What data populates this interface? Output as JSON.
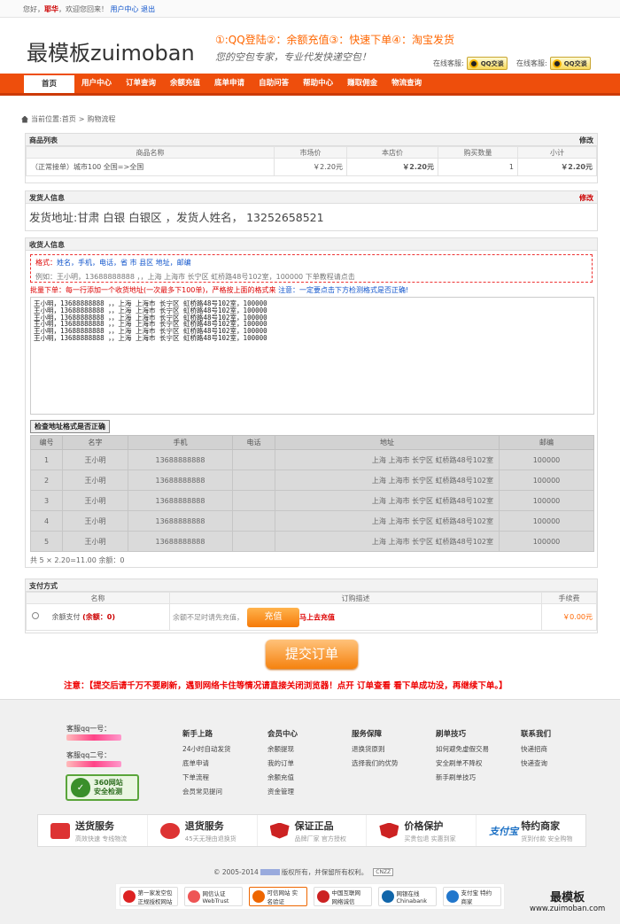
{
  "topbar": {
    "greeting": "您好，",
    "username": "耶华",
    "welcome": "，欢迎您回来！",
    "user_center": "用户中心",
    "logout": "退出"
  },
  "header": {
    "logo": "最模板zuimoban",
    "slogan1": "①:QQ登陆②：余额充值③：快速下单④：淘宝发货",
    "slogan2": "您的空包专家，专业代发快递空包！",
    "kf_label": "在线客服:",
    "qq_btn": "QQ交谈"
  },
  "nav": [
    "首页",
    "用户中心",
    "订单查询",
    "余额充值",
    "底单申请",
    "自助问答",
    "帮助中心",
    "赚取佣金",
    "物流查询"
  ],
  "breadcrumb": {
    "label": "当前位置:",
    "home": "首页",
    "sep": ">",
    "current": "购物流程"
  },
  "goods": {
    "title": "商品列表",
    "edit": "修改",
    "headers": [
      "商品名称",
      "市场价",
      "本店价",
      "购买数量",
      "小计"
    ],
    "row": {
      "name": "（正常接单）城市100 全国=>全国",
      "market": "￥2.20元",
      "shop": "￥2.20元",
      "qty": "1",
      "subtotal": "￥2.20元"
    }
  },
  "sender": {
    "title": "发货人信息",
    "edit": "修改",
    "address": "发货地址:甘肃 白银 白银区 ，发货人姓名， 13252658521"
  },
  "receiver": {
    "title": "收货人信息",
    "format_label": "格式：",
    "format_fields": "姓名，手机，电话，省 市 县区 地址，邮编",
    "example": "例如：王小明，13688888888 ，，上海 上海市 长宁区 虹桥路48号102室，100000 下单教程请点击",
    "batch_note": "批量下单：每一行添加一个收货地址(一次最多下100单)，严格按上面的格式来",
    "batch_note2": "注意：一定要点击下方检测格式是否正确!",
    "textarea": "王小明，13688888888 ，，上海 上海市 长宁区 虹桥路48号102室，100000\n王小明，13688888888 ，，上海 上海市 长宁区 虹桥路48号102室，100000\n王小明，13688888888 ，，上海 上海市 长宁区 虹桥路48号102室，100000\n王小明，13688888888 ，，上海 上海市 长宁区 虹桥路48号102室，100000\n王小明，13688888888 ，，上海 上海市 长宁区 虹桥路48号102室，100000\n王小明，13688888888 ，，上海 上海市 长宁区 虹桥路48号102室，100000",
    "check_btn": "检查地址格式是否正确",
    "parsed_headers": [
      "编号",
      "名字",
      "手机",
      "电话",
      "地址",
      "邮编"
    ],
    "parsed_rows": [
      [
        "1",
        "王小明",
        "13688888888",
        "",
        "上海 上海市 长宁区 虹桥路48号102室",
        "100000"
      ],
      [
        "2",
        "王小明",
        "13688888888",
        "",
        "上海 上海市 长宁区 虹桥路48号102室",
        "100000"
      ],
      [
        "3",
        "王小明",
        "13688888888",
        "",
        "上海 上海市 长宁区 虹桥路48号102室",
        "100000"
      ],
      [
        "4",
        "王小明",
        "13688888888",
        "",
        "上海 上海市 长宁区 虹桥路48号102室",
        "100000"
      ],
      [
        "5",
        "王小明",
        "13688888888",
        "",
        "上海 上海市 长宁区 虹桥路48号102室",
        "100000"
      ]
    ],
    "total": "共 5 × 2.20=11.00 余额：0"
  },
  "payment": {
    "title": "支付方式",
    "headers": [
      "名称",
      "订购描述",
      "手续费"
    ],
    "method": "余额支付",
    "balance": "(余额：0)",
    "desc": "余额不足时请先充值，",
    "recharge_btn": "充值",
    "recharge_link": "马上去充值",
    "fee": "￥0.00元"
  },
  "submit": "提交订单",
  "notice": "注意：【提交后请千万不要刷新，遇到网络卡住等情况请直接关闭浏览器！点开 订单查看 看下单成功没，再继续下单。】",
  "footer": {
    "kf1": "客服qq一号：",
    "kf2": "客服qq二号：",
    "cert360_1": "360网站",
    "cert360_2": "安全检测",
    "cols": [
      {
        "h": "新手上路",
        "items": [
          "24小时自动发货",
          "底单申请",
          "下单流程",
          "会员常见提问"
        ]
      },
      {
        "h": "会员中心",
        "items": [
          "余额提现",
          "我的订单",
          "余额充值",
          "资金管理"
        ]
      },
      {
        "h": "服务保障",
        "items": [
          "退换货原则",
          "选择我们的优势"
        ]
      },
      {
        "h": "刷单技巧",
        "items": [
          "如何避免虚假交易",
          "安全刷单不降权",
          "新手刷单技巧"
        ]
      },
      {
        "h": "联系我们",
        "items": [
          "快递招商",
          "快递查询"
        ]
      }
    ],
    "services": [
      {
        "t1": "送货服务",
        "t2": "高效快速 专线物流",
        "color": "#d33"
      },
      {
        "t1": "退货服务",
        "t2": "45天无理由退换货",
        "color": "#d33"
      },
      {
        "t1": "保证正品",
        "t2": "品牌厂家 官方授权",
        "color": "#c22"
      },
      {
        "t1": "价格保护",
        "t2": "买贵包退 实惠到家",
        "color": "#c22"
      },
      {
        "t1": "特约商家",
        "t2": "货到付款 安全购物",
        "color": "#1a6fc4",
        "brand": "支付宝"
      }
    ],
    "copyright": "© 2005-2014",
    "rights": "版权所有，并保留所有权利。",
    "cnzz": "CNZZ",
    "badges": [
      {
        "t": "第一家发空包正规授权网站",
        "c": "#d22"
      },
      {
        "t": "网信认证 WebTrust",
        "c": "#e55"
      },
      {
        "t": "可信网站 实名验证",
        "c": "#e60"
      },
      {
        "t": "中国互联网 网络诚信",
        "c": "#c22"
      },
      {
        "t": "网银在线 Chinabank",
        "c": "#16a"
      },
      {
        "t": "支付宝 特约商家",
        "c": "#27c"
      }
    ],
    "wm1": "最模板",
    "wm2": "www.zuimoban.com"
  }
}
